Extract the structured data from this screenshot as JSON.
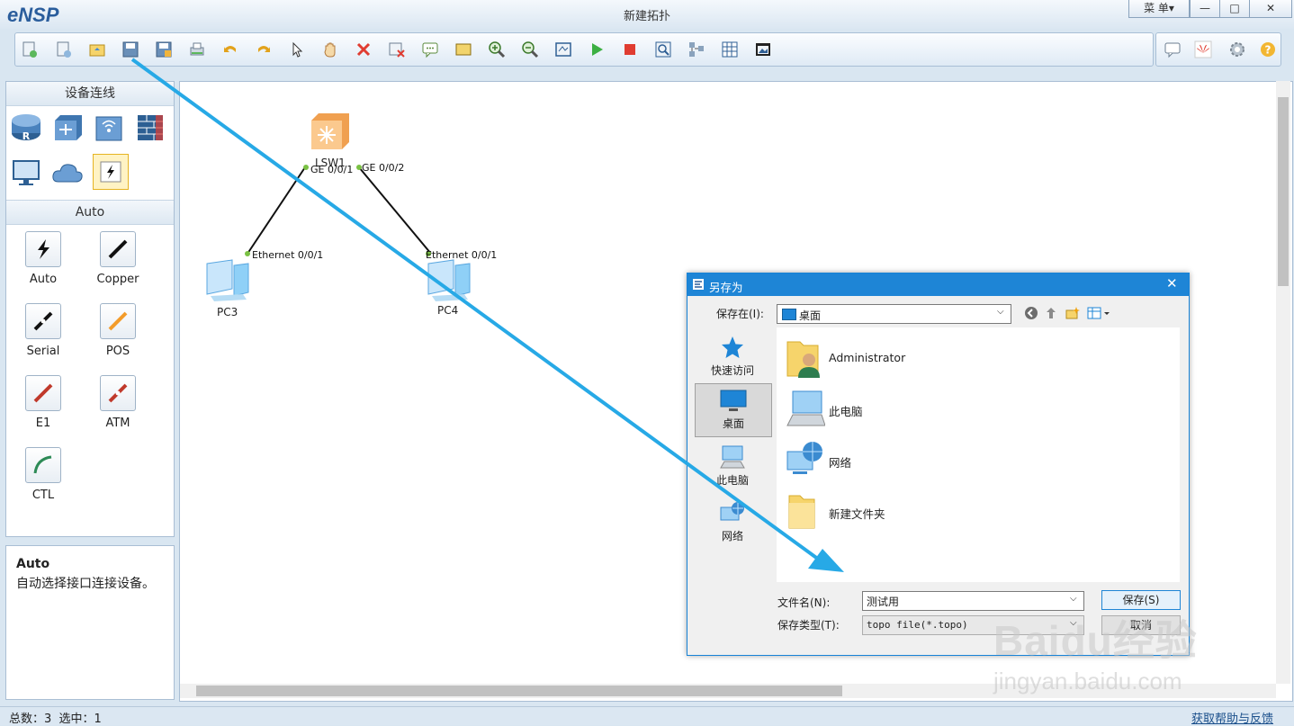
{
  "app": {
    "logo": "eNSP",
    "title": "新建拓扑"
  },
  "window_controls": {
    "menu": "菜 单▾",
    "minimize": "—",
    "maximize": "□",
    "close": "✕"
  },
  "left_panel": {
    "devices_header": "设备连线",
    "devices": [
      "router-icon",
      "switch-icon",
      "wireless-icon",
      "firewall-icon",
      "pc-icon",
      "cloud-icon",
      "connection-icon"
    ],
    "cables_header": "Auto",
    "cables": [
      {
        "label": "Auto",
        "color": "#111111"
      },
      {
        "label": "Copper",
        "color": "#111111"
      },
      {
        "label": "Serial",
        "color": "#111111"
      },
      {
        "label": "POS",
        "color": "#f39c2b"
      },
      {
        "label": "E1",
        "color": "#c0392b"
      },
      {
        "label": "ATM",
        "color": "#c0392b"
      },
      {
        "label": "CTL",
        "color": "#2e8b57"
      }
    ],
    "info_title": "Auto",
    "info_text": "自动选择接口连接设备。"
  },
  "topology": {
    "switch": {
      "name": "LSW1",
      "port1": "GE 0/0/1",
      "port2": "GE 0/0/2"
    },
    "pc3": {
      "name": "PC3",
      "port": "Ethernet 0/0/1"
    },
    "pc4": {
      "name": "PC4",
      "port": "Ethernet 0/0/1"
    }
  },
  "status": {
    "text": "总数：3  选中：1",
    "link": "获取帮助与反馈"
  },
  "dialog": {
    "title": "另存为",
    "save_in_label": "保存在(I):",
    "save_in_value": "桌面",
    "places": [
      {
        "label": "快速访问"
      },
      {
        "label": "桌面"
      },
      {
        "label": "此电脑"
      },
      {
        "label": "网络"
      }
    ],
    "files": [
      {
        "name": "Administrator"
      },
      {
        "name": "此电脑"
      },
      {
        "name": "网络"
      },
      {
        "name": "新建文件夹"
      }
    ],
    "filename_label": "文件名(N):",
    "filename_value": "测试用",
    "filetype_label": "保存类型(T):",
    "filetype_value": "topo file(*.topo)",
    "save_button": "保存(S)",
    "cancel_button": "取消"
  },
  "watermark": {
    "brand": "Baidu经验",
    "url": "jingyan.baidu.com"
  }
}
